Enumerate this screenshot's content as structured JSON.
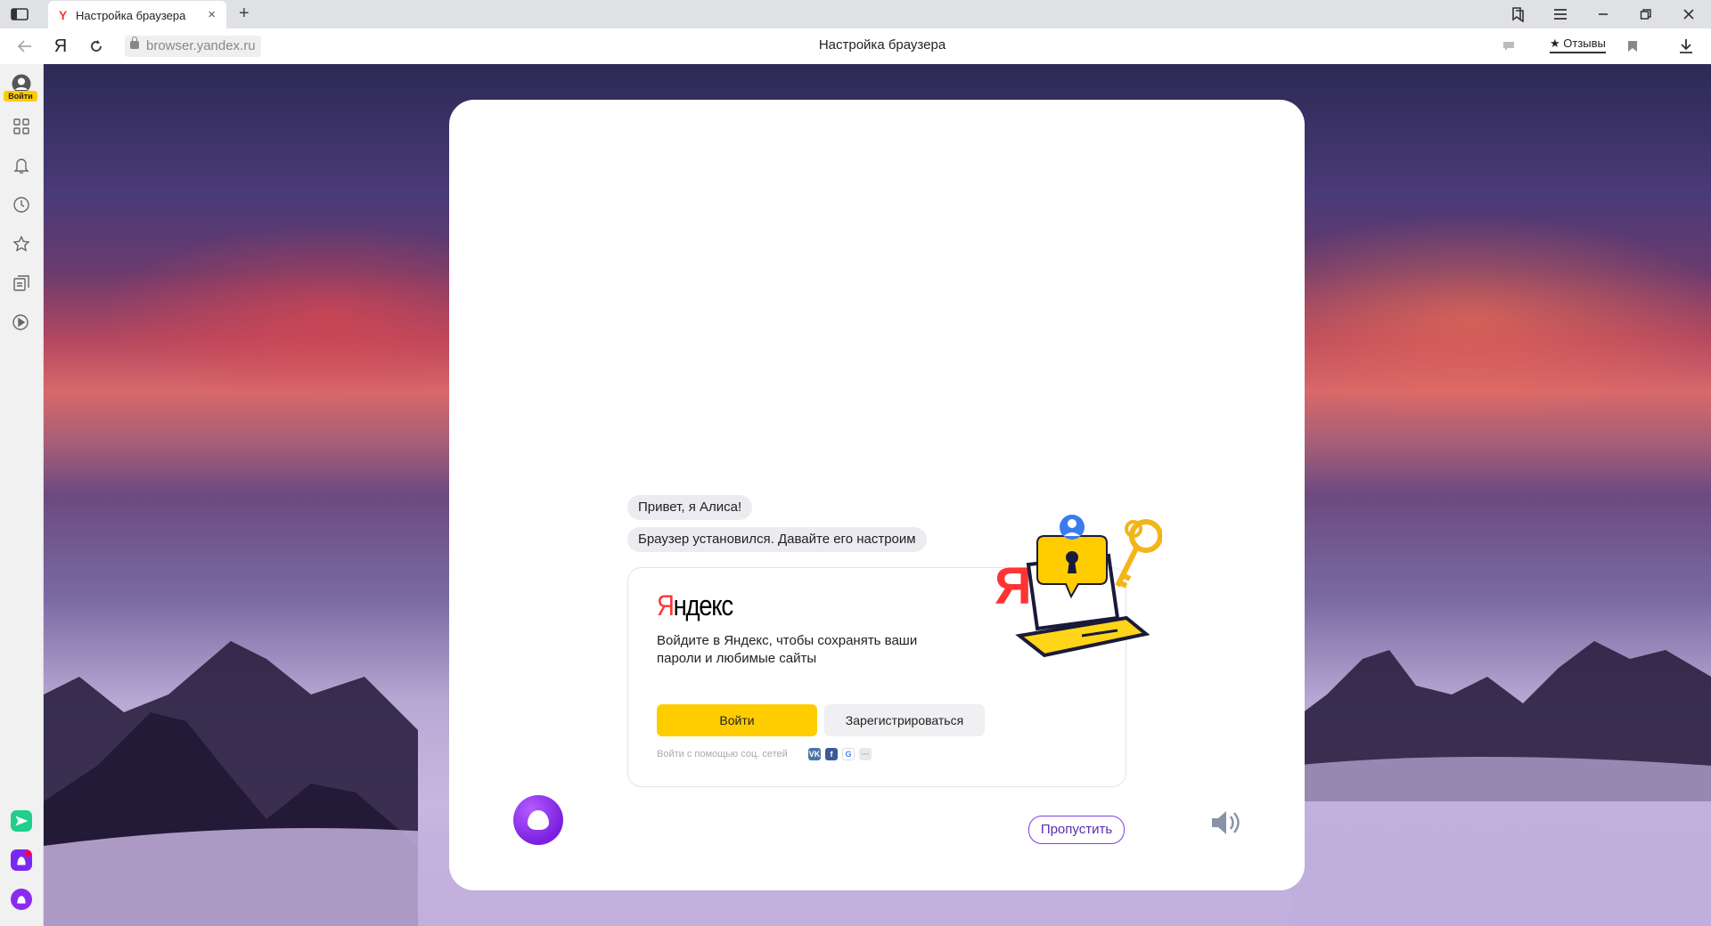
{
  "tab": {
    "title": "Настройка браузера",
    "favicon_letter": "Y",
    "close": "×"
  },
  "new_tab": "+",
  "address_bar": {
    "logo": "Я",
    "url": "browser.yandex.ru",
    "page_title": "Настройка браузера",
    "reviews_label": "★ Отзывы"
  },
  "sidebar": {
    "login_label": "Войти",
    "items": [
      "apps-icon",
      "bell-icon",
      "history-icon",
      "bookmarks-icon",
      "collections-icon",
      "video-icon"
    ],
    "bottom": [
      "messenger-icon",
      "app-icon",
      "alice-icon"
    ]
  },
  "dialog": {
    "bubble1": "Привет, я Алиса!",
    "bubble2": "Браузер установился. Давайте его настроим",
    "card": {
      "logo_first": "Я",
      "logo_rest": "ндекс",
      "description": "Войдите в Яндекс, чтобы сохранять ваши пароли и любимые сайты",
      "login_button": "Войти",
      "register_button": "Зарегистрироваться",
      "social_label": "Войти с помощью соц. сетей",
      "social": [
        "VK",
        "f",
        "G",
        "···"
      ]
    },
    "skip_button": "Пропустить"
  },
  "colors": {
    "accent_yellow": "#ffcc00",
    "alice_purple": "#7b1fe0",
    "skip_border": "#7b3fe4",
    "yandex_red": "#ff3333"
  }
}
